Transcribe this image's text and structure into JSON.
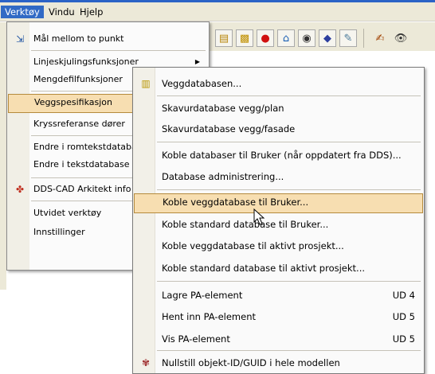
{
  "menubar": {
    "items": [
      {
        "label": "Verktøy",
        "active": true
      },
      {
        "label": "Vindu",
        "active": false
      },
      {
        "label": "Hjelp",
        "active": false
      }
    ]
  },
  "toolbar": {
    "icons": [
      "chart-icon",
      "red-shape-icon",
      "house-icon",
      "camera-icon",
      "blue-object-icon",
      "pencil-scene-icon",
      "edit-icon",
      "eye-icon"
    ]
  },
  "menu1": {
    "items": [
      {
        "label": "Mål mellom to punkt",
        "icon": "measure-icon"
      },
      {
        "label": "Linjeskjulingsfunksjoner",
        "submenu": true
      },
      {
        "label": "Mengdefilfunksjoner"
      },
      {
        "label": "Veggspesifikasjon",
        "selected": true
      },
      {
        "label": "Kryssreferanse dører"
      },
      {
        "label": "Endre i romtekstdatabase"
      },
      {
        "label": "Endre i tekstdatabase"
      },
      {
        "label": "DDS-CAD Arkitekt info",
        "icon": "dds-cad-icon"
      },
      {
        "label": "Utvidet verktøy"
      },
      {
        "label": "Innstillinger"
      }
    ]
  },
  "menu2": {
    "items": [
      {
        "label": "Veggdatabasen...",
        "icon": "wall-database-icon"
      },
      {
        "label": "Skavurdatabase vegg/plan"
      },
      {
        "label": "Skavurdatabase vegg/fasade"
      },
      {
        "label": "Koble databaser til Bruker (når oppdatert fra DDS)..."
      },
      {
        "label": "Database administrering..."
      },
      {
        "label": "Koble veggdatabase til Bruker...",
        "selected": true
      },
      {
        "label": "Koble standard database til Bruker..."
      },
      {
        "label": "Koble veggdatabase til aktivt prosjekt..."
      },
      {
        "label": "Koble standard database til aktivt prosjekt..."
      },
      {
        "label": "Lagre PA-element",
        "shortcut": "UD 4"
      },
      {
        "label": "Hent inn PA-element",
        "shortcut": "UD 5"
      },
      {
        "label": "Vis PA-element",
        "shortcut": "UD 5"
      },
      {
        "label": "Nullstill objekt-ID/GUID i hele modellen",
        "icon": "reset-id-icon"
      }
    ]
  }
}
